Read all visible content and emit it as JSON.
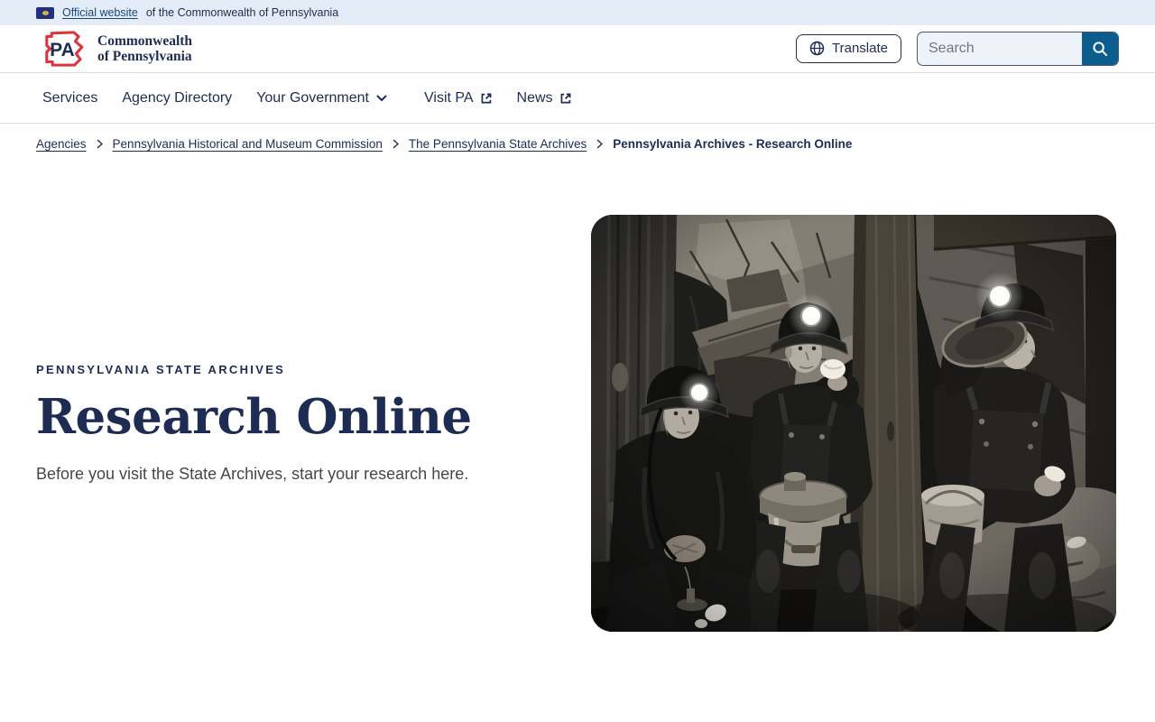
{
  "banner": {
    "link_label": "Official website",
    "suffix_text": "of the Commonwealth of Pennsylvania"
  },
  "header": {
    "logo_monogram": "PA",
    "logo_line1": "Commonwealth",
    "logo_line2": "of Pennsylvania",
    "translate_label": "Translate",
    "search_placeholder": "Search"
  },
  "nav": {
    "items": [
      {
        "label": "Services"
      },
      {
        "label": "Agency Directory"
      },
      {
        "label": "Your Government",
        "has_dropdown": true
      },
      {
        "label": "Visit PA",
        "external": true
      },
      {
        "label": "News",
        "external": true
      }
    ]
  },
  "breadcrumb": {
    "items": [
      {
        "label": "Agencies",
        "link": true
      },
      {
        "label": "Pennsylvania Historical and Museum Commission",
        "link": true
      },
      {
        "label": "The Pennsylvania State Archives",
        "link": true
      },
      {
        "label": "Pennsylvania Archives - Research Online",
        "link": false
      }
    ]
  },
  "hero": {
    "eyebrow": "PENNSYLVANIA STATE ARCHIVES",
    "title": "Research Online",
    "subtitle": "Before you visit the State Archives, start your research here.",
    "image_alt": "Black-and-white photo of three coal miners wearing headlamp caps eating lunch inside a mine"
  },
  "colors": {
    "navy": "#1e2c54",
    "brand_red": "#d8373f",
    "search_button_blue": "#0b5d8e",
    "banner_background": "#e4ecf7"
  }
}
